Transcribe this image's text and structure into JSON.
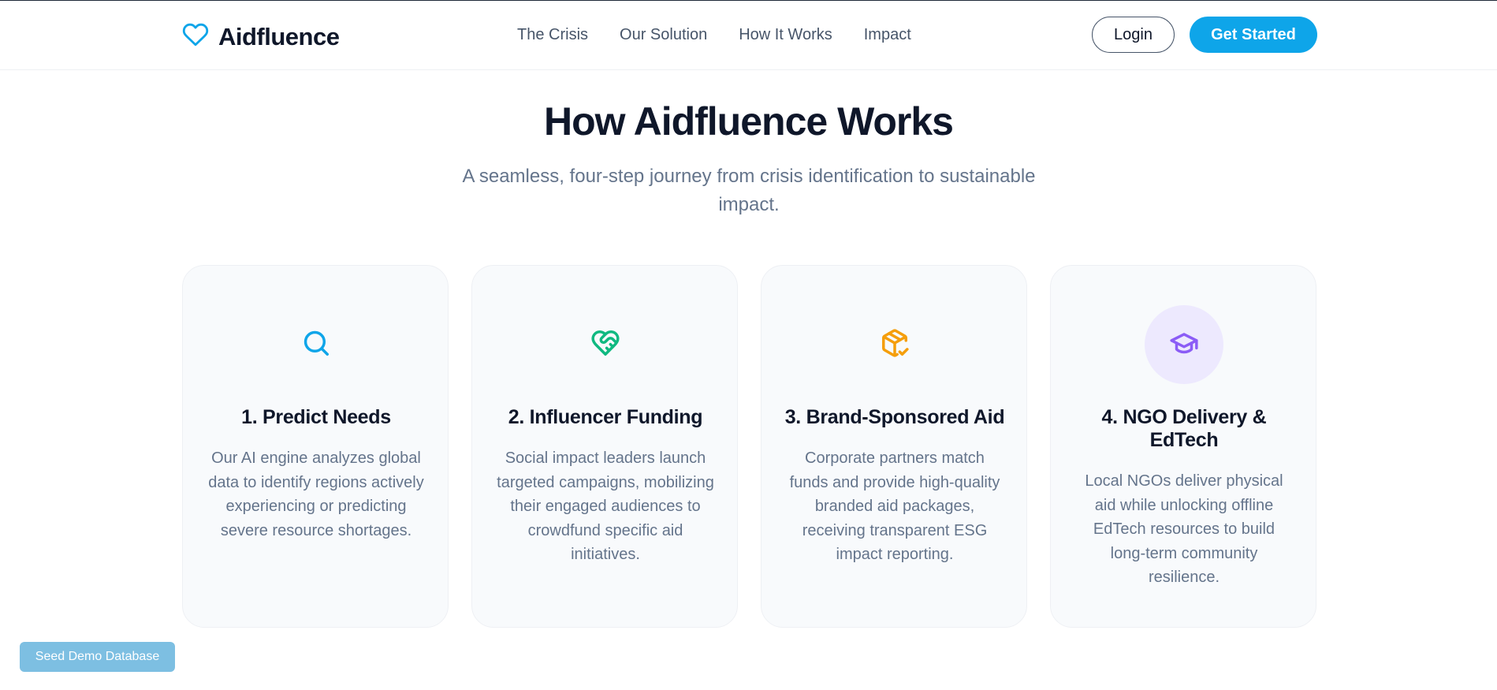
{
  "header": {
    "brand": "Aidfluence",
    "nav": [
      "The Crisis",
      "Our Solution",
      "How It Works",
      "Impact"
    ],
    "login_label": "Login",
    "get_started_label": "Get Started"
  },
  "section": {
    "title": "How Aidfluence Works",
    "subtitle": "A seamless, four-step journey from crisis identification to sustainable impact."
  },
  "steps": [
    {
      "icon": "search-icon",
      "icon_color": "#0ea5e9",
      "title": "1. Predict Needs",
      "description": "Our AI engine analyzes global data to identify regions actively experiencing or predicting severe resource shortages."
    },
    {
      "icon": "heart-handshake-icon",
      "icon_color": "#10b981",
      "title": "2. Influencer Funding",
      "description": "Social impact leaders launch targeted campaigns, mobilizing their engaged audiences to crowdfund specific aid initiatives."
    },
    {
      "icon": "package-check-icon",
      "icon_color": "#f59e0b",
      "title": "3. Brand-Sponsored Aid",
      "description": "Corporate partners match funds and provide high-quality branded aid packages, receiving transparent ESG impact reporting."
    },
    {
      "icon": "graduation-cap-icon",
      "icon_color": "#8b5cf6",
      "title": "4. NGO Delivery & EdTech",
      "description": "Local NGOs deliver physical aid while unlocking offline EdTech resources to build long-term community resilience."
    }
  ],
  "seed_button_label": "Seed Demo Database",
  "colors": {
    "primary": "#0ea5e9",
    "text_dark": "#0f172a",
    "text_muted": "#64748b",
    "card_bg": "#f8fafc"
  }
}
